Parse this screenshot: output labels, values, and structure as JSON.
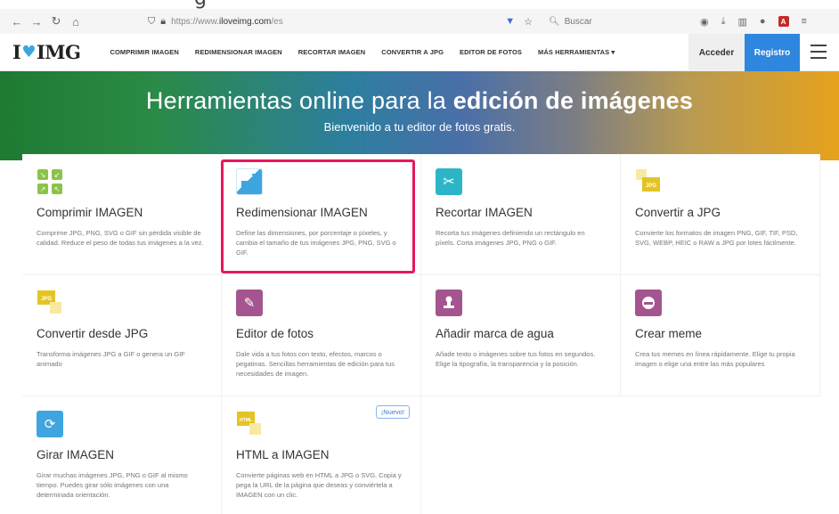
{
  "browser": {
    "url_prefix": "https://www.",
    "url_domain": "iloveimg.com",
    "url_path": "/es",
    "search_placeholder": "Buscar"
  },
  "site": {
    "logo_left": "I",
    "logo_right": "IMG",
    "menu": [
      "COMPRIMIR IMAGEN",
      "REDIMENSIONAR IMAGEN",
      "RECORTAR IMAGEN",
      "CONVERTIR A JPG",
      "EDITOR DE FOTOS",
      "MÁS HERRAMIENTAS ▾"
    ],
    "login": "Acceder",
    "register": "Registro"
  },
  "hero": {
    "title_plain": "Herramientas online para la ",
    "title_bold": "edición de imágenes",
    "subtitle": "Bienvenido a tu editor de fotos gratis."
  },
  "tools": [
    {
      "title": "Comprimir IMAGEN",
      "desc": "Comprime JPG, PNG, SVG o GIF sin pérdida visible de calidad. Reduce el peso de todas tus imágenes a la vez.",
      "icon": "compress-icon"
    },
    {
      "title": "Redimensionar IMAGEN",
      "desc": "Define las dimensiones, por porcentaje o píxeles, y cambia el tamaño de tus imágenes JPG, PNG, SVG o GIF.",
      "icon": "resize-icon"
    },
    {
      "title": "Recortar IMAGEN",
      "desc": "Recorta tus imágenes definiendo un rectángulo en píxels. Corta imágenes JPG, PNG o GIF.",
      "icon": "scissors-icon"
    },
    {
      "title": "Convertir a JPG",
      "desc": "Convierte los formatos de imagen PNG, GIF, TIF, PSD, SVG, WEBP, HEIC o RAW a JPG por lotes fácilmente.",
      "icon": "to-jpg-icon"
    },
    {
      "title": "Convertir desde JPG",
      "desc": "Transforma imágenes JPG a GIF o genera un GIF animado",
      "icon": "from-jpg-icon"
    },
    {
      "title": "Editor de fotos",
      "desc": "Dale vida a tus fotos con texto, efectos, marcos o pegatinas. Sencillas herramientas de edición para tus necesidades de imagen.",
      "icon": "pencil-icon"
    },
    {
      "title": "Añadir marca de agua",
      "desc": "Añade texto o imágenes sobre tus fotos en segundos. Elige la tipografía, la transparencia y la posición.",
      "icon": "stamp-icon"
    },
    {
      "title": "Crear meme",
      "desc": "Crea tus memes en línea rápidamente. Elige tu propia imagen o elige una entre las más populares",
      "icon": "meme-icon"
    },
    {
      "title": "Girar IMAGEN",
      "desc": "Girar muchas imágenes JPG, PNG o GIF al mismo tiempo. Puedes girar sólo imágenes con una determinada orientación.",
      "icon": "rotate-icon"
    },
    {
      "title": "HTML a IMAGEN",
      "desc": "Convierte páginas web en HTML a JPG o SVG. Copia y pega la URL de la página que deseas y conviértela a IMAGEN con un clic.",
      "icon": "html-icon",
      "badge": "¡Nuevo!"
    }
  ],
  "icons": {
    "jpg_label": "JPG",
    "html_label": "HTML"
  }
}
